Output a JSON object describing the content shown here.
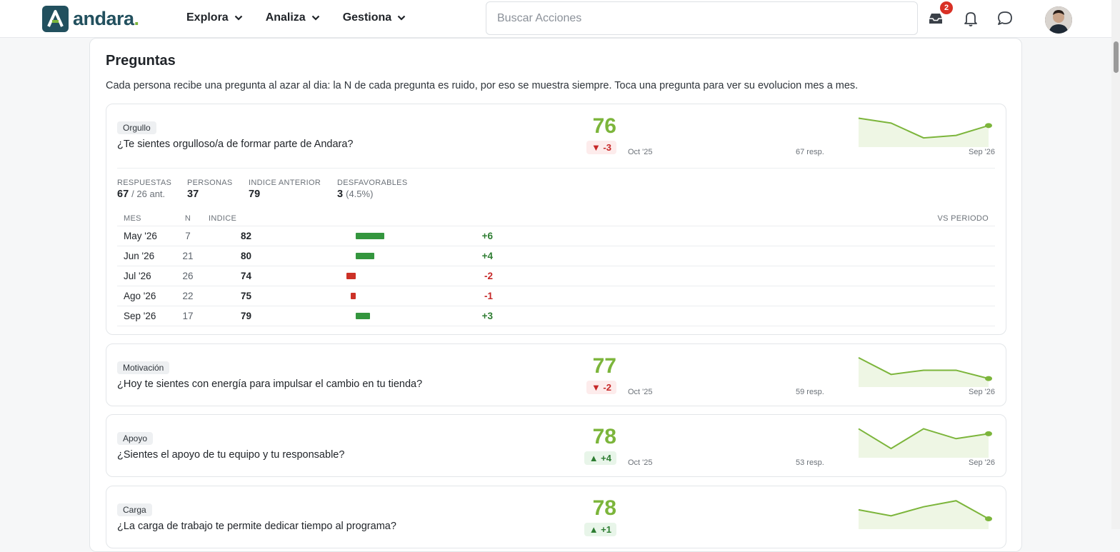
{
  "header": {
    "logo_text": "andara",
    "logo_dot": ".",
    "nav": [
      "Explora",
      "Analiza",
      "Gestiona"
    ],
    "search_placeholder": "Buscar Acciones",
    "inbox_badge": "2"
  },
  "section": {
    "title": "Preguntas",
    "description": "Cada persona recibe una pregunta al azar al dia: la N de cada pregunta es ruido, por eso se muestra siempre. Toca una pregunta para ver su evolucion mes a mes."
  },
  "questions": [
    {
      "tag": "Orgullo",
      "text": "¿Te sientes orgulloso/a de formar parte de Andara?",
      "score": "76",
      "delta": "▼ -3",
      "spark_start": "Oct '25",
      "spark_resp": "67 resp.",
      "spark_end": "Sep '26",
      "spark_values": [
        82,
        80,
        74,
        75,
        79
      ],
      "expanded": true,
      "stats": {
        "respuestas_label": "RESPUESTAS",
        "respuestas_value": "67",
        "respuestas_sub": "/ 26 ant.",
        "personas_label": "PERSONAS",
        "personas_value": "37",
        "indice_anterior_label": "INDICE ANTERIOR",
        "indice_anterior_value": "79",
        "desfavorables_label": "DESFAVORABLES",
        "desfavorables_value": "3",
        "desfavorables_sub": "(4.5%)"
      },
      "table_headers": {
        "mes": "MES",
        "n": "N",
        "indice": "INDICE",
        "vs": "VS PERIODO"
      },
      "months": [
        {
          "mes": "May '26",
          "n": "7",
          "indice": "82",
          "delta": "+6",
          "delta_value": 6
        },
        {
          "mes": "Jun '26",
          "n": "21",
          "indice": "80",
          "delta": "+4",
          "delta_value": 4
        },
        {
          "mes": "Jul '26",
          "n": "26",
          "indice": "74",
          "delta": "-2",
          "delta_value": -2
        },
        {
          "mes": "Ago '26",
          "n": "22",
          "indice": "75",
          "delta": "-1",
          "delta_value": -1
        },
        {
          "mes": "Sep '26",
          "n": "17",
          "indice": "79",
          "delta": "+3",
          "delta_value": 3
        }
      ]
    },
    {
      "tag": "Motivación",
      "text": "¿Hoy te sientes con energía para impulsar el cambio en tu tienda?",
      "score": "77",
      "delta": "▼ -2",
      "spark_start": "Oct '25",
      "spark_resp": "59 resp.",
      "spark_end": "Sep '26",
      "spark_values": [
        86,
        78,
        80,
        80,
        76
      ]
    },
    {
      "tag": "Apoyo",
      "text": "¿Sientes el apoyo de tu equipo y tu responsable?",
      "score": "78",
      "delta": "▲ +4",
      "spark_start": "Oct '25",
      "spark_resp": "53 resp.",
      "spark_end": "Sep '26",
      "spark_values": [
        80,
        72,
        80,
        76,
        78
      ]
    },
    {
      "tag": "Carga",
      "text": "¿La carga de trabajo te permite dedicar tiempo al programa?",
      "score": "78",
      "delta": "▲ +1",
      "spark_values": [
        79,
        77,
        80,
        82,
        76
      ]
    }
  ]
}
